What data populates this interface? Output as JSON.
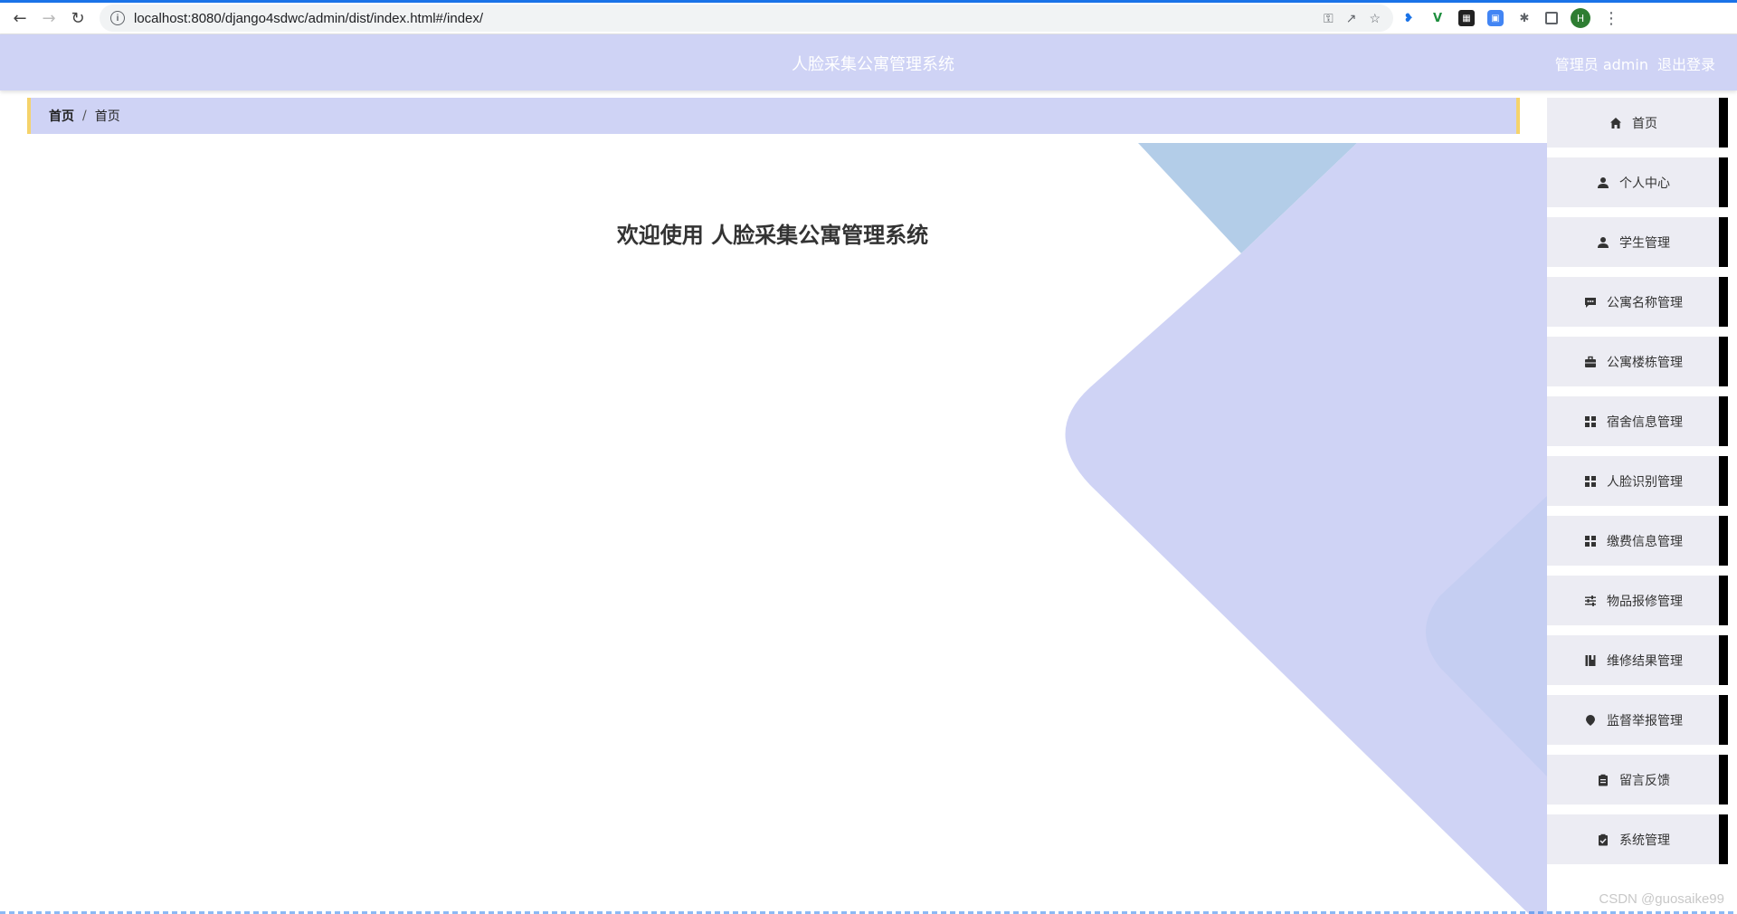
{
  "browser": {
    "url": "localhost:8080/django4sdwc/admin/dist/index.html#/index/",
    "profile_initial": "H"
  },
  "header": {
    "title": "人脸采集公寓管理系统",
    "role_user": "管理员 admin",
    "logout": "退出登录"
  },
  "breadcrumb": {
    "home": "首页",
    "separator": "/",
    "current": "首页"
  },
  "main": {
    "welcome": "欢迎使用 人脸采集公寓管理系统"
  },
  "sidebar": {
    "items": [
      {
        "label": "首页",
        "icon": "home-icon"
      },
      {
        "label": "个人中心",
        "icon": "user-icon"
      },
      {
        "label": "学生管理",
        "icon": "user-icon"
      },
      {
        "label": "公寓名称管理",
        "icon": "message-icon"
      },
      {
        "label": "公寓楼栋管理",
        "icon": "briefcase-icon"
      },
      {
        "label": "宿舍信息管理",
        "icon": "grid-icon"
      },
      {
        "label": "人脸识别管理",
        "icon": "grid-icon"
      },
      {
        "label": "缴费信息管理",
        "icon": "grid-icon"
      },
      {
        "label": "物品报修管理",
        "icon": "sliders-icon"
      },
      {
        "label": "维修结果管理",
        "icon": "book-icon"
      },
      {
        "label": "监督举报管理",
        "icon": "location-icon"
      },
      {
        "label": "留言反馈",
        "icon": "clipboard-icon"
      },
      {
        "label": "系统管理",
        "icon": "clipboard-check-icon"
      }
    ]
  },
  "watermark": "CSDN @guosaike99",
  "colors": {
    "accent": "#cfd3f5",
    "breadcrumb_border": "#f5d36b",
    "menu_bg": "#ececf3",
    "shape_light_blue": "#b3cde8"
  }
}
